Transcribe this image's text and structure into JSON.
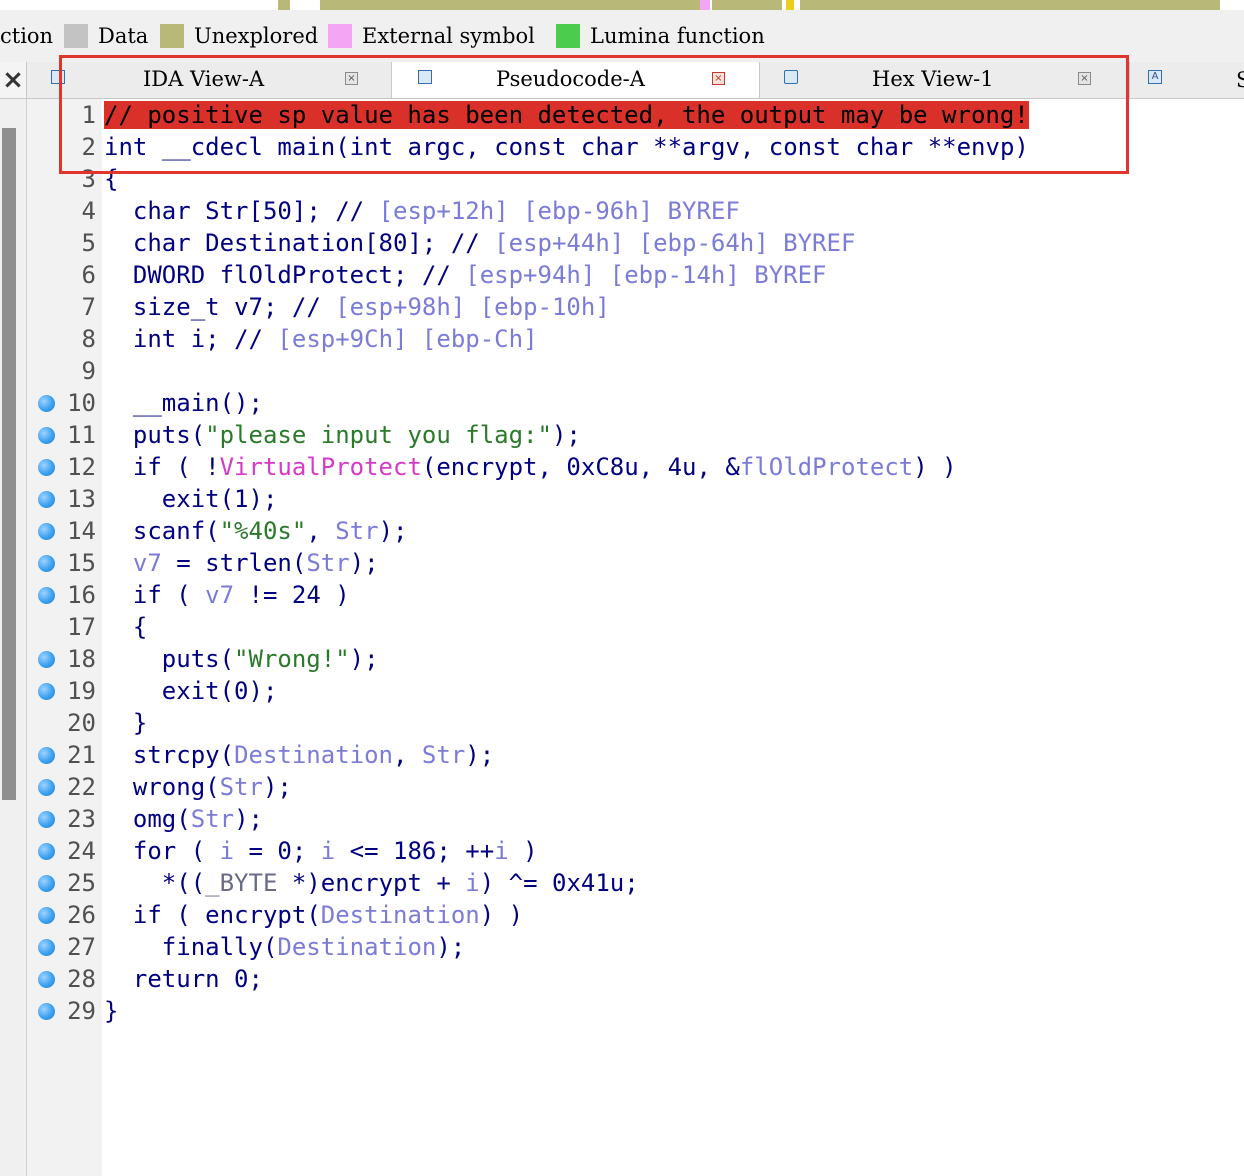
{
  "legend": {
    "items": [
      {
        "label": "ction",
        "color": null
      },
      {
        "label": "Data",
        "color": "#c3c3c3"
      },
      {
        "label": "Unexplored",
        "color": "#b8b878"
      },
      {
        "label": "External symbol",
        "color": "#f4a6f4"
      },
      {
        "label": "Lumina function",
        "color": "#4ccc4c"
      }
    ]
  },
  "tabs": [
    {
      "label": "IDA View-A",
      "active": false
    },
    {
      "label": "Pseudocode-A",
      "active": true
    },
    {
      "label": "Hex View-1",
      "active": false
    }
  ],
  "tab_overflow_label": "S",
  "code": {
    "lines": [
      {
        "n": "1",
        "bp": false,
        "text": "// positive sp value has been detected, the output may be wrong!"
      },
      {
        "n": "2",
        "bp": false,
        "text": "int __cdecl main(int argc, const char **argv, const char **envp)"
      },
      {
        "n": "3",
        "bp": false,
        "text": "{"
      },
      {
        "n": "4",
        "bp": false,
        "text": "  char Str[50]; // [esp+12h] [ebp-96h] BYREF"
      },
      {
        "n": "5",
        "bp": false,
        "text": "  char Destination[80]; // [esp+44h] [ebp-64h] BYREF"
      },
      {
        "n": "6",
        "bp": false,
        "text": "  DWORD flOldProtect; // [esp+94h] [ebp-14h] BYREF"
      },
      {
        "n": "7",
        "bp": false,
        "text": "  size_t v7; // [esp+98h] [ebp-10h]"
      },
      {
        "n": "8",
        "bp": false,
        "text": "  int i; // [esp+9Ch] [ebp-Ch]"
      },
      {
        "n": "9",
        "bp": false,
        "text": ""
      },
      {
        "n": "10",
        "bp": true,
        "text": "  __main();"
      },
      {
        "n": "11",
        "bp": true,
        "text": "  puts(\"please input you flag:\");"
      },
      {
        "n": "12",
        "bp": true,
        "text": "  if ( !VirtualProtect(encrypt, 0xC8u, 4u, &flOldProtect) )"
      },
      {
        "n": "13",
        "bp": true,
        "text": "    exit(1);"
      },
      {
        "n": "14",
        "bp": true,
        "text": "  scanf(\"%40s\", Str);"
      },
      {
        "n": "15",
        "bp": true,
        "text": "  v7 = strlen(Str);"
      },
      {
        "n": "16",
        "bp": true,
        "text": "  if ( v7 != 24 )"
      },
      {
        "n": "17",
        "bp": false,
        "text": "  {"
      },
      {
        "n": "18",
        "bp": true,
        "text": "    puts(\"Wrong!\");"
      },
      {
        "n": "19",
        "bp": true,
        "text": "    exit(0);"
      },
      {
        "n": "20",
        "bp": false,
        "text": "  }"
      },
      {
        "n": "21",
        "bp": true,
        "text": "  strcpy(Destination, Str);"
      },
      {
        "n": "22",
        "bp": true,
        "text": "  wrong(Str);"
      },
      {
        "n": "23",
        "bp": true,
        "text": "  omg(Str);"
      },
      {
        "n": "24",
        "bp": true,
        "text": "  for ( i = 0; i <= 186; ++i )"
      },
      {
        "n": "25",
        "bp": true,
        "text": "    *((_BYTE *)encrypt + i) ^= 0x41u;"
      },
      {
        "n": "26",
        "bp": true,
        "text": "  if ( encrypt(Destination) )"
      },
      {
        "n": "27",
        "bp": true,
        "text": "    finally(Destination);"
      },
      {
        "n": "28",
        "bp": true,
        "text": "  return 0;"
      },
      {
        "n": "29",
        "bp": true,
        "text": "}"
      }
    ]
  },
  "colors": {
    "banner": "#d9302a",
    "highlight_box": "#e0342c",
    "identifier": "#000080",
    "variable": "#7b7bd8",
    "string": "#2b7a2b",
    "import": "#d63ac7"
  }
}
